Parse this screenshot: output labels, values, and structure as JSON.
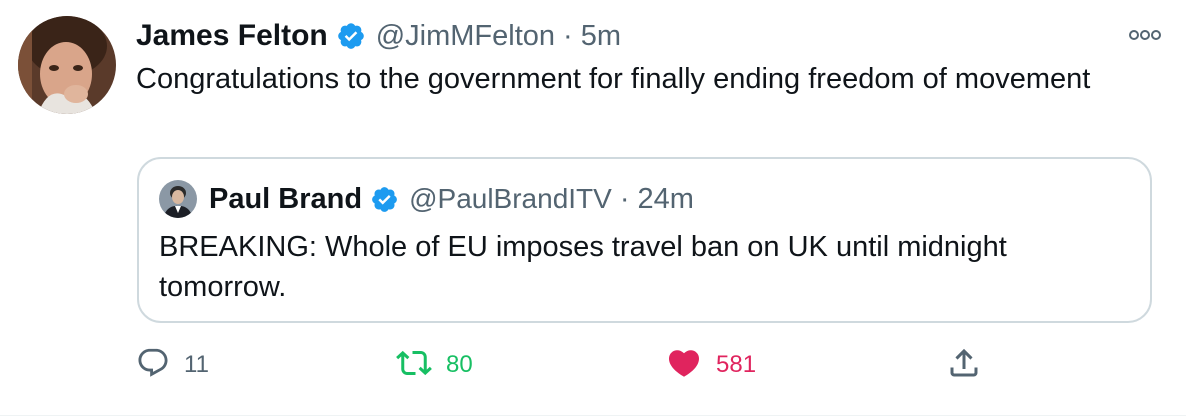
{
  "tweet": {
    "author_name": "James Felton",
    "author_handle": "@JimMFelton",
    "separator": "·",
    "time": "5m",
    "text": "Congratulations to the government for finally ending freedom of movement"
  },
  "quoted_tweet": {
    "author_name": "Paul Brand",
    "author_handle": "@PaulBrandITV",
    "separator": "·",
    "time": "24m",
    "text": "BREAKING: Whole of EU imposes travel ban on UK until midnight tomorrow."
  },
  "actions": {
    "reply_count": "11",
    "retweet_count": "80",
    "like_count": "581"
  },
  "icons": {
    "verified": "verified-badge-icon",
    "more": "more-options-icon",
    "reply": "reply-icon",
    "retweet": "retweet-icon",
    "like": "heart-icon",
    "share": "share-icon"
  },
  "colors": {
    "verified_blue": "#1d9bf0",
    "retweet_green": "#17bf63",
    "like_red": "#e0245e",
    "secondary_text": "#536471",
    "quote_border": "#cfd9de"
  }
}
